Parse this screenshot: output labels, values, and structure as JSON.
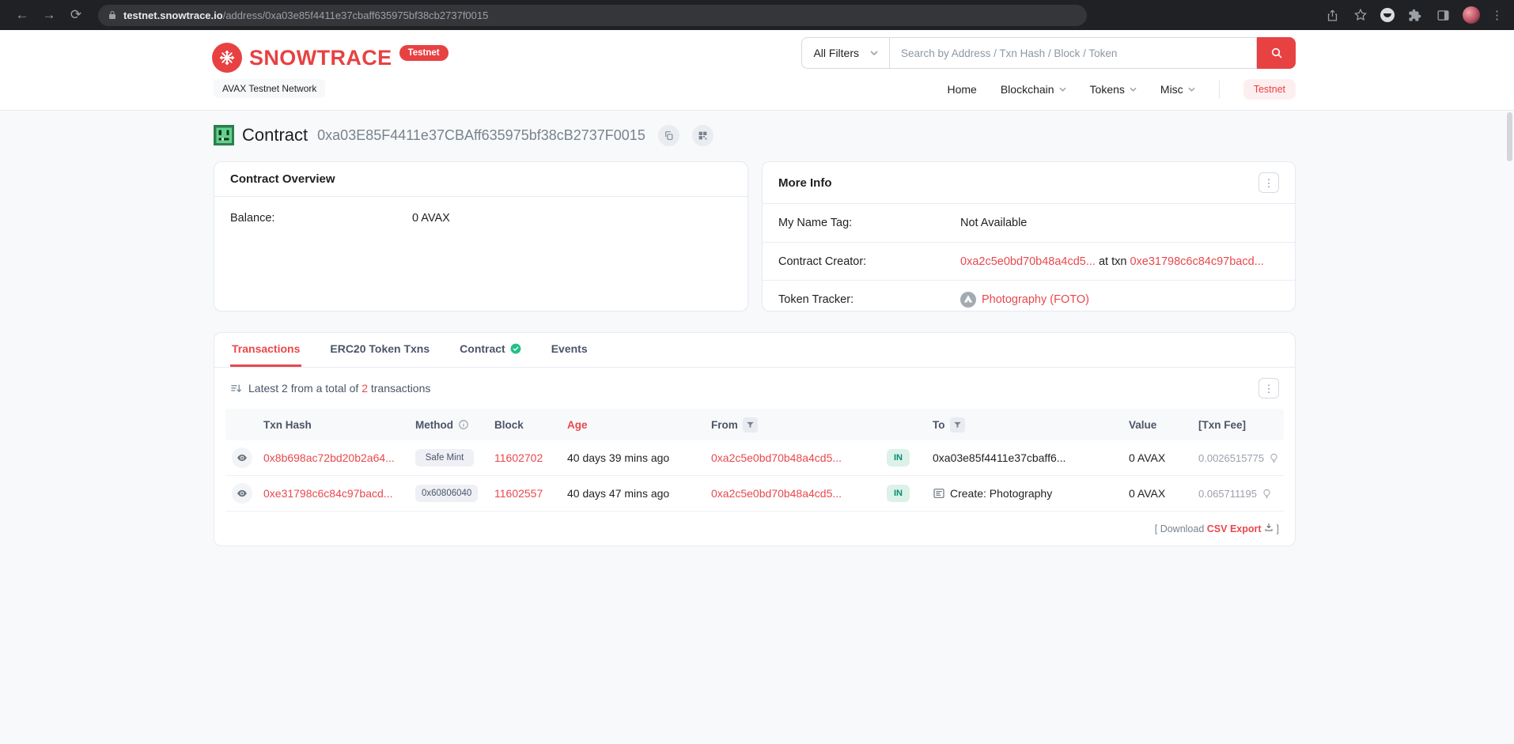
{
  "browser": {
    "url_domain": "testnet.snowtrace.io",
    "url_path": "/address/0xa03e85f4411e37cbaff635975bf38cb2737f0015"
  },
  "header": {
    "brand": "SNOWTRACE",
    "brand_badge": "Testnet",
    "network_label": "AVAX Testnet Network",
    "search": {
      "filter_label": "All Filters",
      "placeholder": "Search by Address / Txn Hash / Block / Token"
    },
    "nav": [
      {
        "label": "Home",
        "chevron": false
      },
      {
        "label": "Blockchain",
        "chevron": true
      },
      {
        "label": "Tokens",
        "chevron": true
      },
      {
        "label": "Misc",
        "chevron": true
      }
    ],
    "testnet_button": "Testnet"
  },
  "page": {
    "title": "Contract",
    "address": "0xa03E85F4411e37CBAff635975bf38cB2737F0015"
  },
  "overview": {
    "title": "Contract Overview",
    "balance_label": "Balance:",
    "balance_value": "0 AVAX"
  },
  "more_info": {
    "title": "More Info",
    "name_tag_label": "My Name Tag:",
    "name_tag_value": "Not Available",
    "creator_label": "Contract Creator:",
    "creator_address": "0xa2c5e0bd70b48a4cd5...",
    "creator_at": "at txn",
    "creator_txn": "0xe31798c6c84c97bacd...",
    "tracker_label": "Token Tracker:",
    "tracker_value": "Photography (FOTO)"
  },
  "tabs": [
    {
      "label": "Transactions",
      "active": true,
      "check": false
    },
    {
      "label": "ERC20 Token Txns",
      "active": false,
      "check": false
    },
    {
      "label": "Contract",
      "active": false,
      "check": true
    },
    {
      "label": "Events",
      "active": false,
      "check": false
    }
  ],
  "transactions": {
    "summary": {
      "prefix": "Latest 2 from a total of",
      "count": "2",
      "suffix": "transactions"
    },
    "columns": {
      "hash": "Txn Hash",
      "method": "Method",
      "block": "Block",
      "age": "Age",
      "from": "From",
      "to": "To",
      "value": "Value",
      "fee": "[Txn Fee]"
    },
    "rows": [
      {
        "hash": "0x8b698ac72bd20b2a64...",
        "method": "Safe Mint",
        "block": "11602702",
        "age": "40 days 39 mins ago",
        "from": "0xa2c5e0bd70b48a4cd5...",
        "dir": "IN",
        "to": "0xa03e85f4411e37cbaff6...",
        "to_icon": false,
        "value": "0 AVAX",
        "fee": "0.0026515775"
      },
      {
        "hash": "0xe31798c6c84c97bacd...",
        "method": "0x60806040",
        "block": "11602557",
        "age": "40 days 47 mins ago",
        "from": "0xa2c5e0bd70b48a4cd5...",
        "dir": "IN",
        "to": "Create: Photography",
        "to_icon": true,
        "value": "0 AVAX",
        "fee": "0.065711195"
      }
    ],
    "download": {
      "open": "[ Download",
      "link": "CSV Export",
      "close": "]"
    }
  },
  "colors": {
    "brand": "#e84142",
    "link": "#e8484d",
    "in_badge_bg": "#dcf1e8",
    "in_badge_text": "#028e71"
  }
}
